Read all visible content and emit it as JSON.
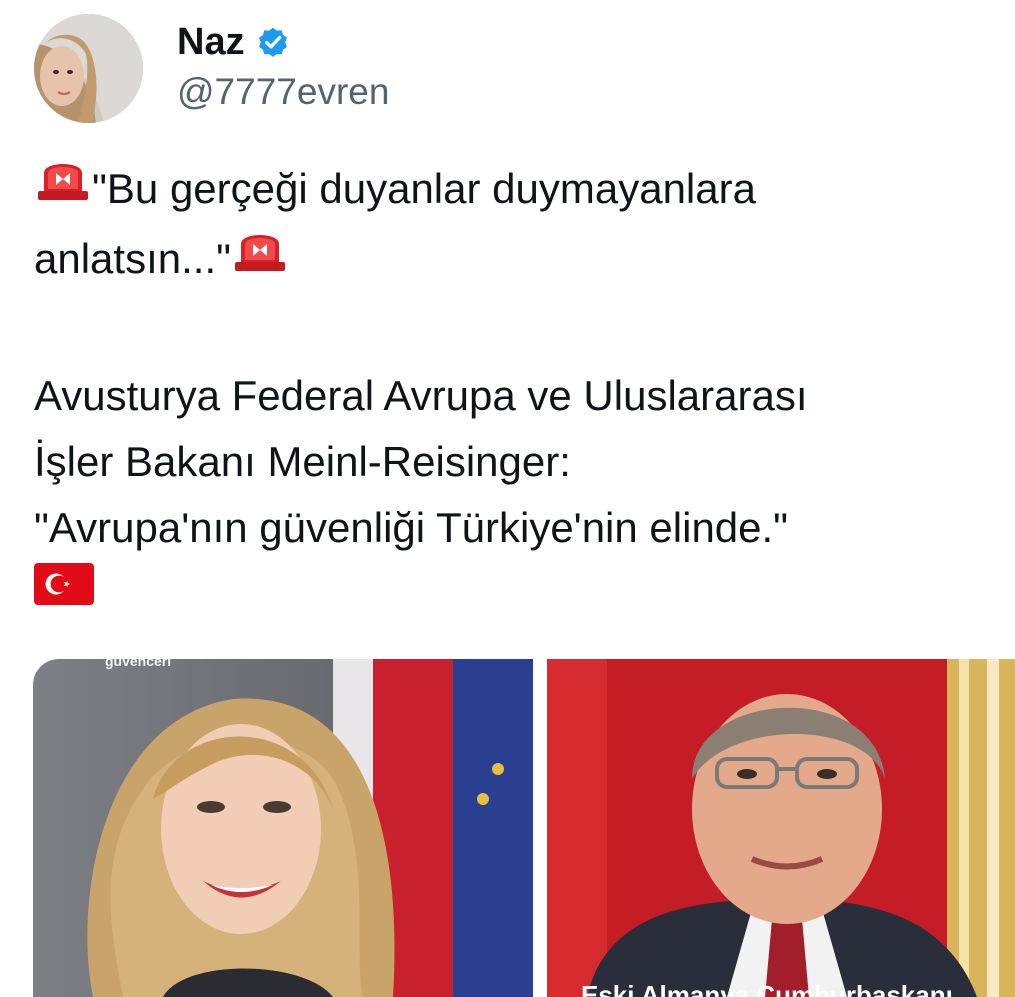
{
  "user": {
    "display_name": "Naz",
    "handle": "@7777evren",
    "verified": true,
    "avatar_icon": "profile-photo"
  },
  "tweet": {
    "line1": "\"Bu gerçeği duyanlar duymayanlara",
    "line2": "anlatsın...\"",
    "line3": "Avusturya Federal Avrupa ve Uluslararası",
    "line4": "İşler Bakanı Meinl-Reisinger:",
    "line5": "\"Avrupa'nın güvenliği Türkiye'nin elinde.\"",
    "emojis": [
      "rotating-light-emoji",
      "turkey-flag-emoji"
    ]
  },
  "media": {
    "left_caption": "güvenceri",
    "right_caption": "Eski Almanya Cumhurbaşkanı"
  },
  "colors": {
    "verified_blue": "#1d9bf0",
    "handle_gray": "#536471",
    "text": "#0f1419",
    "flag_red": "#e30a17"
  }
}
